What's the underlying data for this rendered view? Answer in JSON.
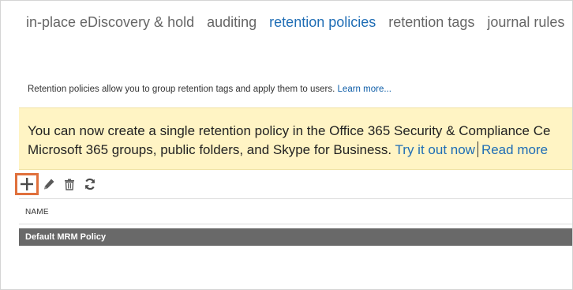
{
  "tabs": [
    {
      "label": "in-place eDiscovery & hold",
      "active": false
    },
    {
      "label": "auditing",
      "active": false
    },
    {
      "label": "retention policies",
      "active": true
    },
    {
      "label": "retention tags",
      "active": false
    },
    {
      "label": "journal rules",
      "active": false
    }
  ],
  "description": {
    "text": "Retention policies allow you to group retention tags and apply them to users.",
    "link": "Learn more..."
  },
  "banner": {
    "line1": "You can now create a single retention policy in the Office 365 Security & Compliance Ce",
    "line2": "Microsoft 365 groups, public folders, and Skype for Business.",
    "link1": "Try it out now",
    "link2": "Read more"
  },
  "toolbar": {
    "icons": [
      "add-icon",
      "edit-icon",
      "delete-icon",
      "refresh-icon"
    ],
    "highlight_color": "#e0703c"
  },
  "table": {
    "columns": [
      "NAME"
    ],
    "rows": [
      {
        "name": "Default MRM Policy",
        "selected": true
      }
    ]
  },
  "colors": {
    "accent": "#1f6db5",
    "banner_bg": "#fff4c4",
    "selected_row": "#696969"
  }
}
